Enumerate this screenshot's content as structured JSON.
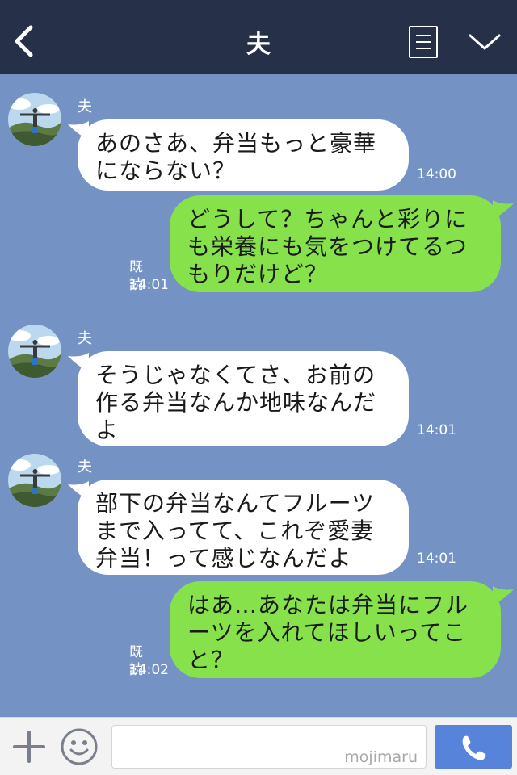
{
  "header": {
    "title": "夫",
    "back_icon": "chevron-left-icon",
    "menu_icon": "list-icon",
    "collapse_icon": "chevron-down-icon"
  },
  "messages": [
    {
      "side": "in",
      "sender": "夫",
      "text": [
        "あのさあ、弁当もっと豪華",
        "にならない？"
      ],
      "time": "14:00"
    },
    {
      "side": "out",
      "read": "既読",
      "text": [
        "どうして？ちゃんと彩りに",
        "も栄養にも気をつけてるつ",
        "もりだけど？"
      ],
      "time": "14:01"
    },
    {
      "side": "in",
      "sender": "夫",
      "text": [
        "そうじゃなくてさ、お前の",
        "作る弁当なんか地味なんだ",
        "よ"
      ],
      "time": "14:01"
    },
    {
      "side": "in",
      "sender": "夫",
      "text": [
        "部下の弁当なんてフルーツ",
        "まで入ってて、これぞ愛妻",
        "弁当！って感じなんだよ"
      ],
      "time": "14:01"
    },
    {
      "side": "out",
      "read": "既読",
      "text": [
        "はあ…あなたは弁当にフル",
        "ーツを入れてほしいってこ",
        "と？"
      ],
      "time": "14:02"
    }
  ],
  "footer": {
    "plus_icon": "plus-icon",
    "emoji_icon": "smiley-icon",
    "watermark": "mojimaru",
    "call_icon": "phone-icon"
  },
  "colors": {
    "header_bg": "#263048",
    "chat_bg": "#7493c4",
    "incoming_bubble": "#ffffff",
    "outgoing_bubble": "#86e14a",
    "call_button": "#5883da"
  }
}
